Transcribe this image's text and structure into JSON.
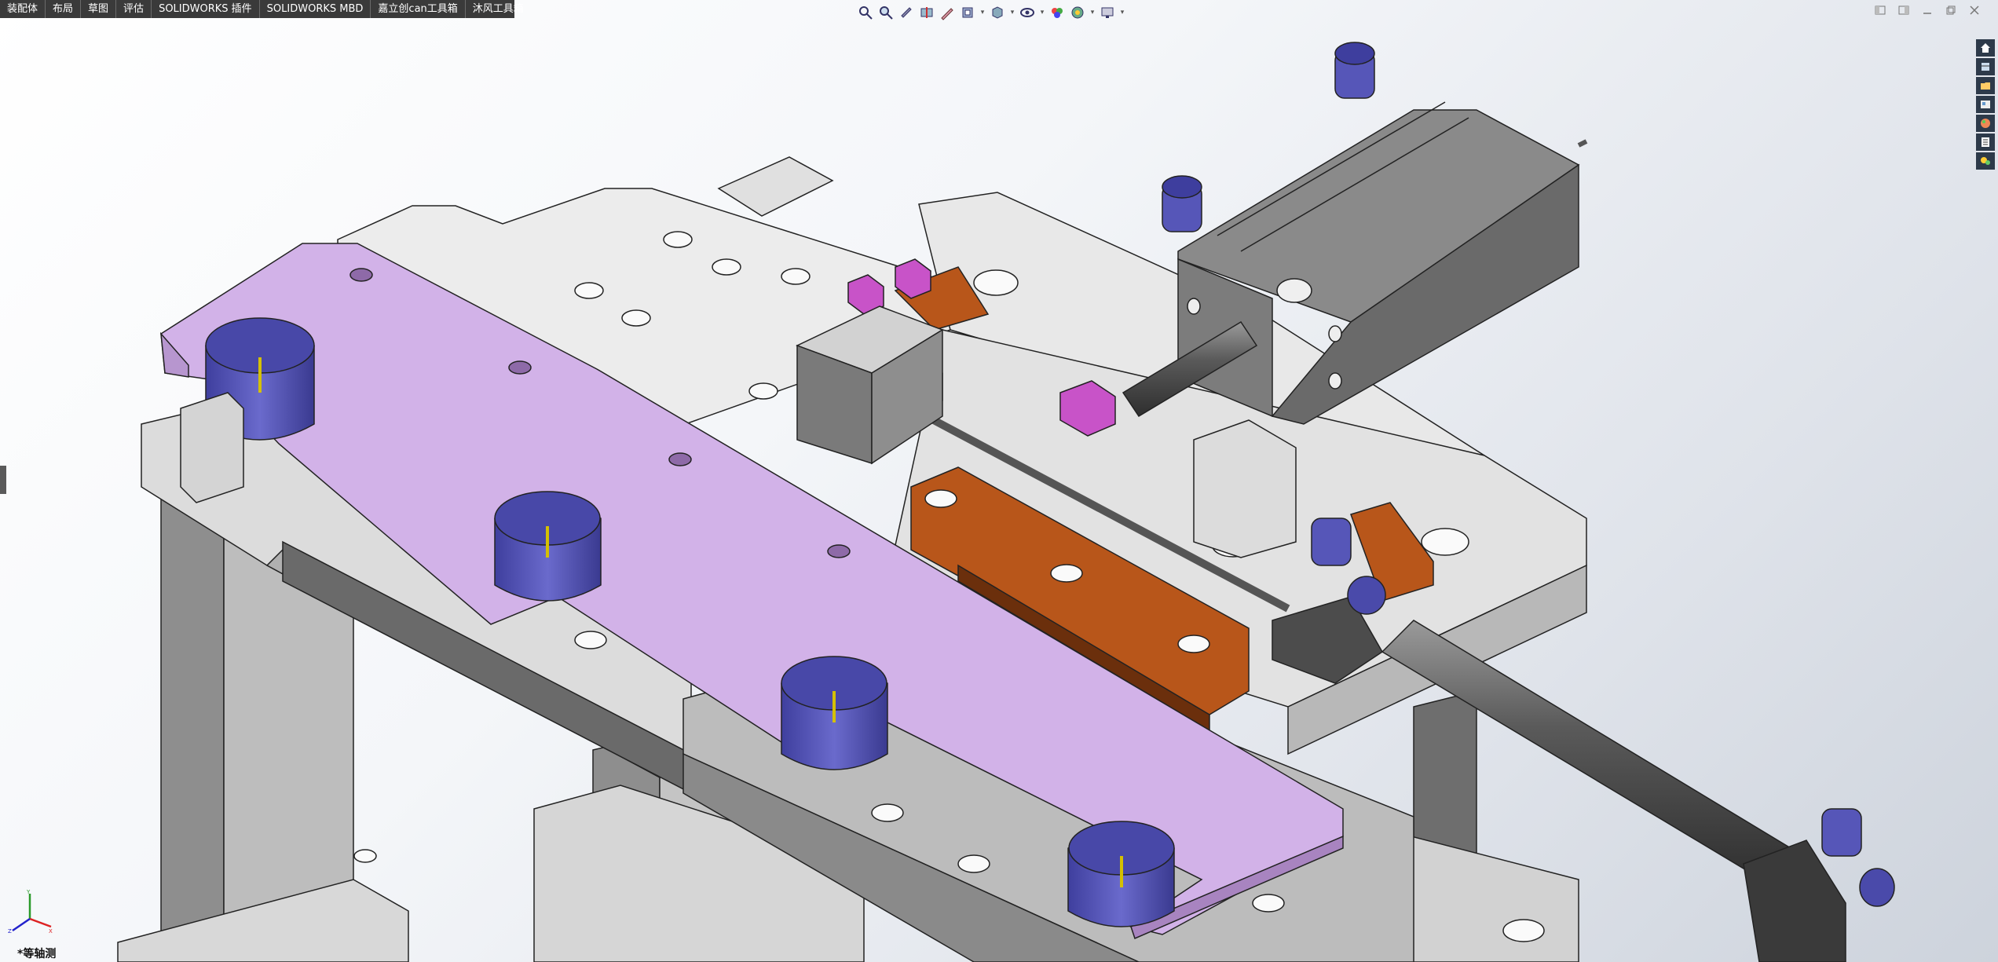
{
  "tabs": [
    "装配体",
    "布局",
    "草图",
    "评估",
    "SOLIDWORKS 插件",
    "SOLIDWORKS MBD",
    "嘉立创can工具箱",
    "沐风工具箱"
  ],
  "heads_up_icons": [
    "zoom-to-fit-icon",
    "zoom-to-area-icon",
    "previous-view-icon",
    "section-view-icon",
    "dynamic-annotation-icon",
    "view-orientation-icon",
    "display-style-icon",
    "hide-show-items-icon",
    "edit-appearance-icon",
    "apply-scene-icon",
    "view-settings-icon"
  ],
  "window_controls": [
    "tile-left-icon",
    "tile-right-icon",
    "minimize-icon",
    "restore-icon",
    "close-icon"
  ],
  "task_pane_icons": [
    "solidworks-resources-icon",
    "design-library-icon",
    "file-explorer-icon",
    "view-palette-icon",
    "appearances-scenes-icon",
    "custom-properties-icon",
    "solidworks-forum-icon"
  ],
  "view_label": "*等轴测",
  "triad": {
    "x": "X",
    "y": "Y",
    "z": "Z"
  },
  "colors": {
    "toolbar_bg": "#3a3a3a",
    "purple_plate": "#d2b2e8",
    "blue_cup": "#5656b8",
    "magenta_nut": "#c853c8",
    "orange_rail": "#b8561a",
    "steel_gray": "#7a7a7a",
    "light_gray": "#e6e6e6"
  }
}
